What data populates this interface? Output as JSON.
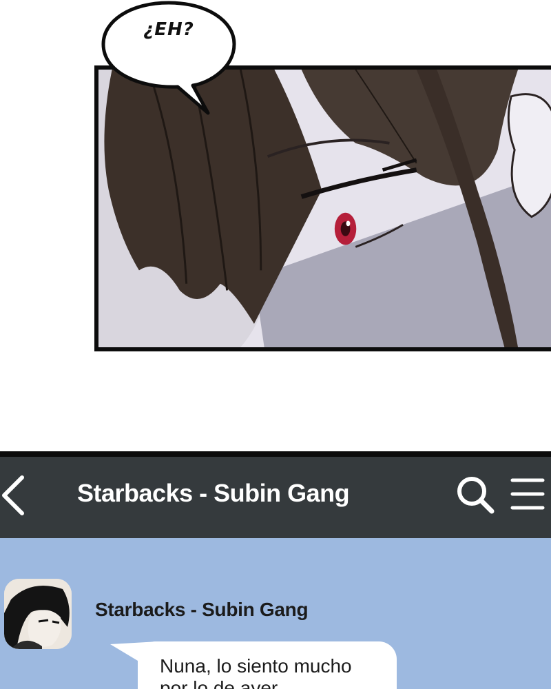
{
  "speech_bubble": {
    "text": "¿EH?"
  },
  "chat": {
    "header": {
      "title": "Starbacks - Subin Gang",
      "back_icon": "chevron-left-icon",
      "search_icon": "search-icon",
      "menu_icon": "hamburger-menu-icon"
    },
    "message": {
      "sender": "Starbacks - Subin Gang",
      "text": "Nuna, lo siento mucho\npor lo de ayer..."
    }
  },
  "colors": {
    "header_bg": "#353a3d",
    "chat_bg": "#9db9e0",
    "bubble_bg": "#ffffff",
    "panel_border": "#0c0c0c",
    "hair": "#3c3029",
    "skin_shadow": "#a5a4b4",
    "eye": "#b51f3a"
  }
}
